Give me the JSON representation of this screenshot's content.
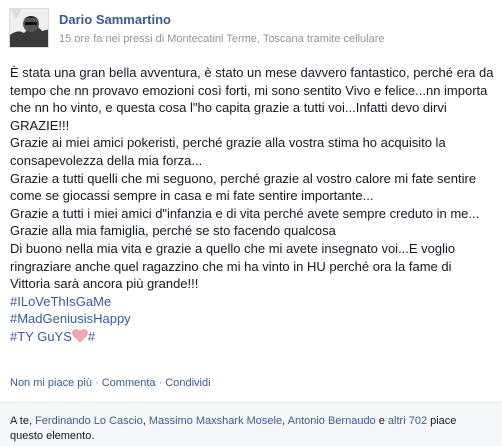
{
  "post": {
    "author": "Dario Sammartino",
    "meta": {
      "time": "15 ore fa",
      "location_prefix": " nei pressi di ",
      "location": "Montecatini Terme, Toscana",
      "via": " tramite cellulare"
    },
    "lines": [
      "È stata una gran bella avventura, è stato un mese davvero fantastico, perché era da",
      "tempo che nn provavo emozioni così forti, mi sono sentito Vivo e felice...nn importa",
      "che nn ho vinto, e questa cosa l\"ho capita grazie a tutti voi...Infatti devo dirvi",
      "GRAZIE!!!",
      "Grazie ai miei amici pokeristi, perché grazie alla vostra stima ho acquisito la",
      "consapevolezza della mia forza...",
      "Grazie a tutti quelli che mi seguono, perché grazie al vostro calore mi fate sentire",
      "come se giocassi sempre in casa e mi fate sentire importante...",
      "Grazie a tutti i miei amici d\"infanzia e di vita perché avete sempre creduto in me...",
      "Grazie alla mia famiglia, perché se sto facendo qualcosa",
      "Di buono nella mia vita e grazie a quello che mi avete insegnato voi...E voglio",
      "ringraziare anche quel ragazzino che mi ha vinto in HU perché ora la fame di",
      "Vittoria sarà ancora più grande!!!"
    ],
    "hashtags": [
      "#ILoVeThIsGaMe",
      "#MadGeniusisHappy"
    ],
    "last_line": {
      "tag": "#TY GuYS",
      "suffix": "#",
      "heart_icon": "heart-icon"
    }
  },
  "actions": {
    "unlike": "Non mi piace più",
    "comment": "Commenta",
    "share": "Condividi",
    "separator": " · "
  },
  "likes": {
    "prefix": "A te, ",
    "names": [
      "Ferdinando Lo Cascio",
      "Massimo Maxshark Mosele",
      "Antonio Bernaudo"
    ],
    "comma": ", ",
    "and": " e ",
    "others": "altri 702",
    "suffix": " piace questo elemento."
  },
  "colors": {
    "link": "#3b5998",
    "meta": "#90949c",
    "text": "#141823",
    "heart": "#f4a6b2"
  }
}
